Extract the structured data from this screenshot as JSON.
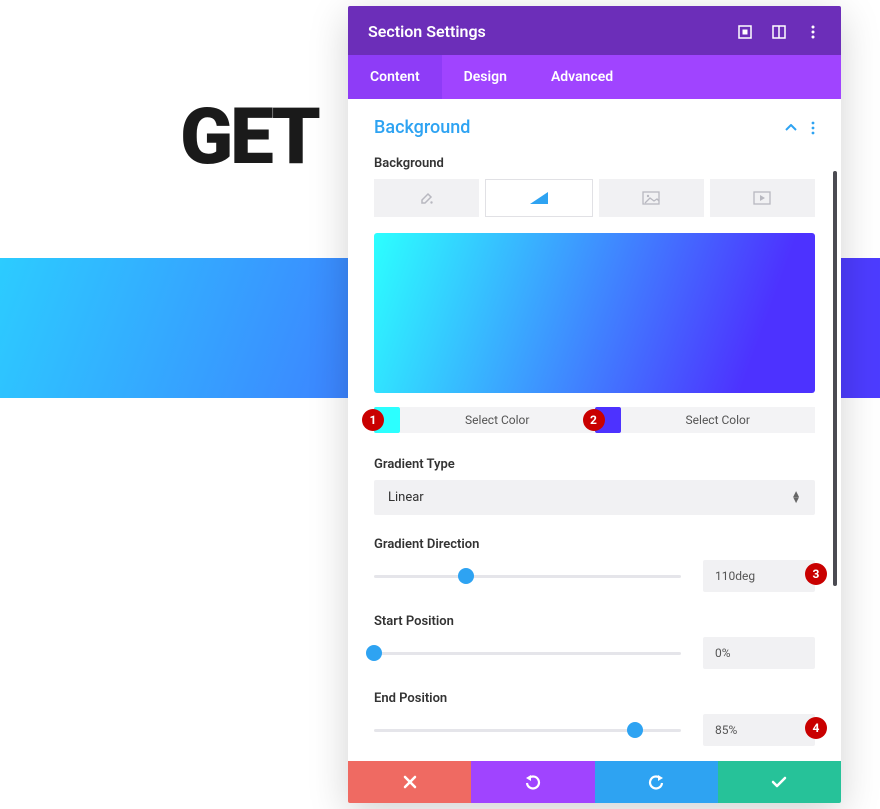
{
  "background_page": {
    "heading": "GET"
  },
  "modal": {
    "title": "Section Settings",
    "tabs": [
      "Content",
      "Design",
      "Advanced"
    ],
    "active_tab": "Content",
    "panel": {
      "title": "Background",
      "subheader": "Background",
      "bg_type_selected": "gradient",
      "gradient": {
        "start_color": "#2cffff",
        "end_color": "#4d32ff",
        "select_color_label": "Select Color",
        "type_label": "Gradient Type",
        "type_value": "Linear",
        "direction_label": "Gradient Direction",
        "direction_value": "110deg",
        "direction_percent": 30,
        "start_label": "Start Position",
        "start_value": "0%",
        "start_percent": 0,
        "end_label": "End Position",
        "end_value": "85%",
        "end_percent": 85
      }
    }
  },
  "callouts": {
    "c1": "1",
    "c2": "2",
    "c3": "3",
    "c4": "4"
  },
  "colors": {
    "preview_gradient_css": "linear-gradient(110deg,#2cffff 0%,#4d32ff 85%)"
  }
}
